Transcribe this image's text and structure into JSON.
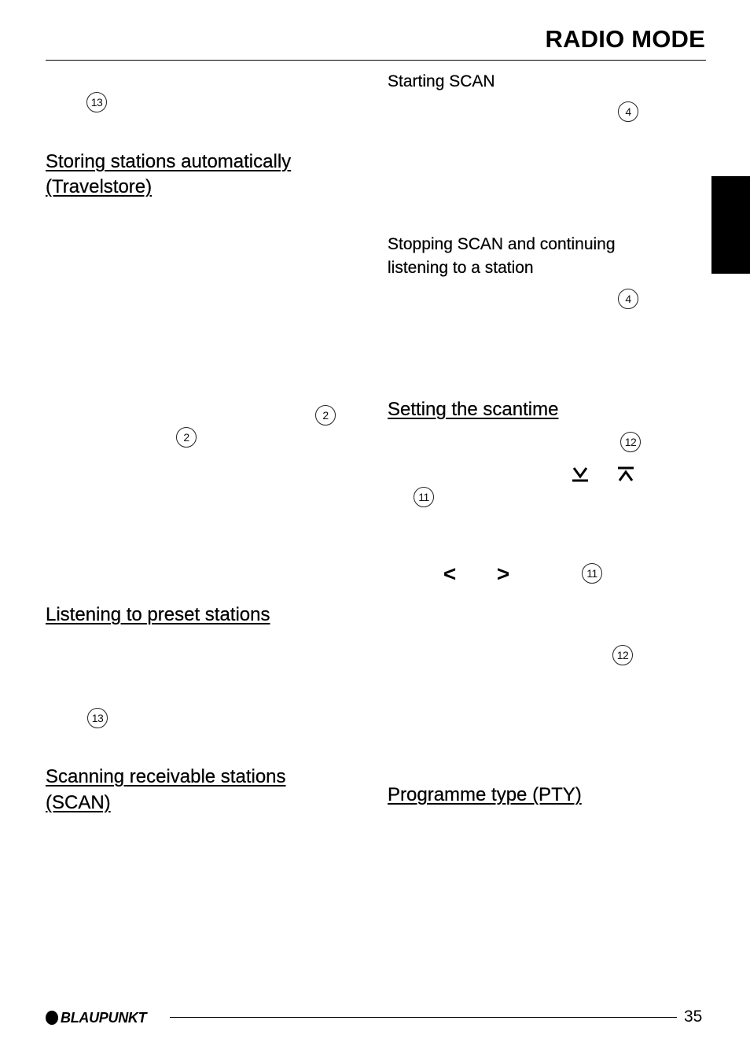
{
  "header": {
    "title": "RADIO MODE"
  },
  "left_column": {
    "callouts": {
      "c13_top": "13",
      "c2_right": "2",
      "c2_left": "2",
      "c13_bottom": "13"
    },
    "headings": {
      "travelstore_line1": "Storing stations automatically",
      "travelstore_line2": "(Travelstore)",
      "preset": "Listening to preset stations",
      "scan_line1": "Scanning receivable stations",
      "scan_line2": "(SCAN)"
    }
  },
  "right_column": {
    "subheadings": {
      "starting_scan": "Starting SCAN",
      "stopping_line1": "Stopping SCAN and continuing",
      "stopping_line2": "listening to a station"
    },
    "headings": {
      "scantime": "Setting the scantime",
      "pty": "Programme type (PTY)"
    },
    "callouts": {
      "c4_start": "4",
      "c4_stop": "4",
      "c12_top": "12",
      "c11_left": "11",
      "c11_right": "11",
      "c12_bottom": "12"
    },
    "glyphs": {
      "left_arrow": "<",
      "right_arrow": ">"
    }
  },
  "icons": {
    "down_button": "down-key-symbol",
    "up_button": "up-key-symbol"
  },
  "side_tab_color": "#000000",
  "footer": {
    "brand": "BLAUPUNKT",
    "page_number": "35"
  }
}
